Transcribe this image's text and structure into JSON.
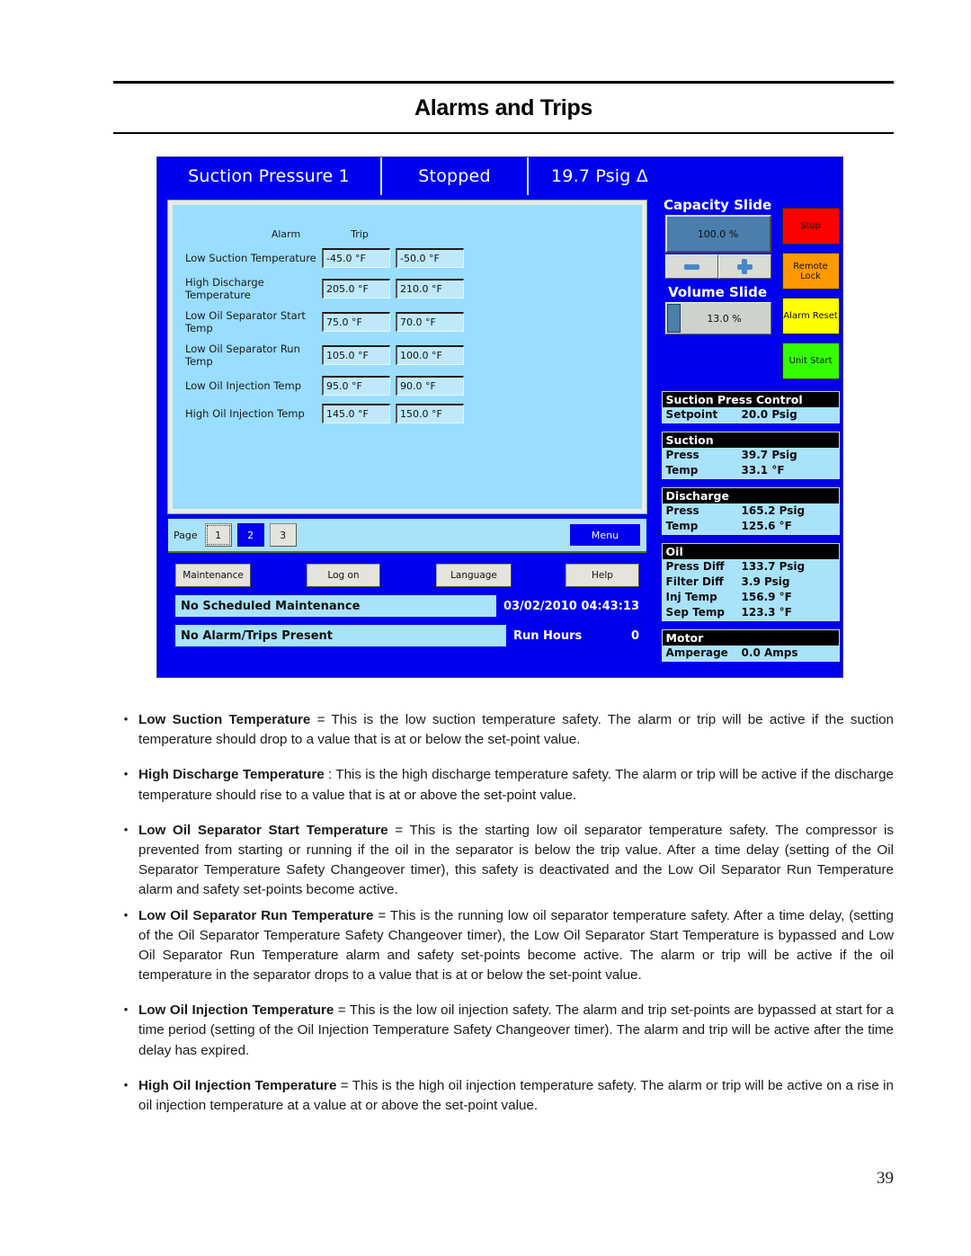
{
  "document": {
    "title": "Alarms and Trips",
    "page_number": "39"
  },
  "hmi": {
    "header": {
      "title": "Suction Pressure 1",
      "status": "Stopped",
      "value": "19.7 Psig Δ"
    },
    "table": {
      "col_alarm": "Alarm",
      "col_trip": "Trip",
      "rows": [
        {
          "label": "Low Suction Temperature",
          "alarm": "-45.0 °F",
          "trip": "-50.0 °F"
        },
        {
          "label": "High Discharge Temperature",
          "alarm": "205.0 °F",
          "trip": "210.0 °F"
        },
        {
          "label": "Low Oil Separator Start Temp",
          "alarm": "75.0 °F",
          "trip": "70.0 °F"
        },
        {
          "label": "Low Oil Separator Run Temp",
          "alarm": "105.0 °F",
          "trip": "100.0 °F"
        },
        {
          "label": "Low Oil Injection Temp",
          "alarm": "95.0 °F",
          "trip": "90.0 °F"
        },
        {
          "label": "High Oil Injection Temp",
          "alarm": "145.0 °F",
          "trip": "150.0 °F"
        }
      ]
    },
    "nav": {
      "page_label": "Page",
      "pages": [
        "1",
        "2",
        "3"
      ],
      "selected_page": "2",
      "menu_label": "Menu"
    },
    "actions": {
      "maintenance": "Maintenance",
      "log_on": "Log on",
      "language": "Language",
      "help": "Help"
    },
    "status": {
      "maintenance_message": "No Scheduled Maintenance",
      "alarm_message": "No Alarm/Trips Present",
      "datetime": "03/02/2010  04:43:13",
      "run_hours_label": "Run Hours",
      "run_hours_value": "0"
    },
    "capacity_slide": {
      "title": "Capacity Slide",
      "value": "100.0 %",
      "decrease_label": "minus-icon",
      "increase_label": "plus-icon"
    },
    "volume_slide": {
      "title": "Volume Slide",
      "value": "13.0 %",
      "fill_percent": 13
    },
    "control_buttons": [
      {
        "label": "Stop",
        "color": "#ff0000"
      },
      {
        "label": "Remote Lock",
        "color": "#ff9900"
      },
      {
        "label": "Alarm Reset",
        "color": "#ffff00"
      },
      {
        "label": "Unit Start",
        "color": "#33ff00"
      }
    ],
    "groups": [
      {
        "title": "Suction Press Control",
        "rows": [
          {
            "key": "Setpoint",
            "value": "20.0 Psig"
          }
        ]
      },
      {
        "title": "Suction",
        "rows": [
          {
            "key": "Press",
            "value": "39.7 Psig"
          },
          {
            "key": "Temp",
            "value": "33.1 °F"
          }
        ]
      },
      {
        "title": "Discharge",
        "rows": [
          {
            "key": "Press",
            "value": "165.2 Psig"
          },
          {
            "key": "Temp",
            "value": "125.6 °F"
          }
        ]
      },
      {
        "title": "Oil",
        "rows": [
          {
            "key": "Press Diff",
            "value": "133.7 Psig"
          },
          {
            "key": "Filter Diff",
            "value": "3.9 Psig"
          },
          {
            "key": "Inj Temp",
            "value": "156.9 °F"
          },
          {
            "key": "Sep Temp",
            "value": "123.3 °F"
          }
        ]
      },
      {
        "title": "Motor",
        "rows": [
          {
            "key": "Amperage",
            "value": "0.0 Amps"
          }
        ]
      }
    ],
    "colors": {
      "panel_blue": "#0000ee",
      "light_blue": "#99ddff",
      "readout_blue": "#a9e2fb",
      "header_black": "#000000"
    }
  },
  "bullets": [
    {
      "term": "Low Suction Temperature",
      "rest": " = This is the low suction temperature safety.  The alarm or trip will be active if the suction temperature should drop to a value that is at or below the set-point value."
    },
    {
      "term": "High Discharge Temperature",
      "rest": " : This is the high discharge temperature safety.  The alarm or trip will be active if the discharge temperature should rise to a value that is at or above the set-point value."
    },
    {
      "term": "Low Oil Separator Start Temperature",
      "rest": " = This is the starting low oil separator temperature safety.  The compressor is prevented from starting or running if the oil in the separator is below the trip value.  After a time delay (setting of the Oil Separator Temperature Safety Changeover timer), this safety is deactivated and the Low Oil Separator Run Temperature alarm and safety set-points become active."
    },
    {
      "term": "Low Oil Separator Run Temperature",
      "rest": " = This is the running low oil separator temperature safety.  After a time delay, (setting of the Oil Separator Temperature Safety Changeover timer), the Low Oil Separator Start Temperature is bypassed and Low Oil Separator Run Temperature alarm and safety set-points become active. The alarm or trip will be active if the oil temperature in the separator drops to a value that is at or below the set-point value."
    },
    {
      "term": "Low Oil Injection Temperature",
      "rest": " = This is the low oil injection safety.  The alarm and trip set-points are bypassed at start for a time period (setting of the Oil Injection Temperature Safety Changeover timer). The alarm and trip will be active after the time delay has expired."
    },
    {
      "term": "High Oil Injection Temperature",
      "rest": " = This is the high oil injection temperature safety.  The alarm or trip will be active on a rise in oil injection temperature at a value at or above the set-point value."
    }
  ],
  "bullet_marker": "•"
}
